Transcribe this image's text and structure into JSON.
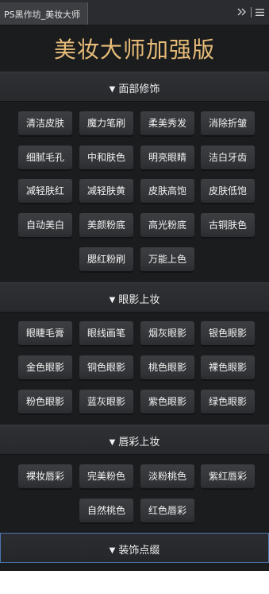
{
  "tab": {
    "label": "PS黑作坊_美妆大师"
  },
  "toolbar": {
    "collapse_icon": "double-chevron-right-icon",
    "menu_icon": "hamburger-menu-icon"
  },
  "app_title": "美妆大师加强版",
  "colors": {
    "title_gold": "#e8bc78",
    "panel_bg": "#1b1c1e",
    "active_border": "#4a76b0"
  },
  "sections": [
    {
      "title": "面部修饰",
      "expanded": true,
      "buttons": [
        "清洁皮肤",
        "魔力笔刷",
        "柔美秀发",
        "消除折皱",
        "细腻毛孔",
        "中和肤色",
        "明亮眼睛",
        "洁白牙齿",
        "减轻肤红",
        "减轻肤黄",
        "皮肤高饱",
        "皮肤低饱",
        "自动美白",
        "美颜粉底",
        "高光粉底",
        "古铜肤色",
        "腮红粉刷",
        "万能上色"
      ]
    },
    {
      "title": "眼影上妆",
      "expanded": true,
      "buttons": [
        "眼睫毛膏",
        "眼线画笔",
        "烟灰眼影",
        "银色眼影",
        "金色眼影",
        "铜色眼影",
        "桃色眼影",
        "裸色眼影",
        "粉色眼影",
        "蓝灰眼影",
        "紫色眼影",
        "绿色眼影"
      ]
    },
    {
      "title": "唇彩上妆",
      "expanded": true,
      "buttons": [
        "裸妆唇彩",
        "完美粉色",
        "淡粉桃色",
        "紫红唇彩",
        "自然桃色",
        "红色唇彩"
      ]
    },
    {
      "title": "装饰点缀",
      "expanded": false,
      "buttons": []
    }
  ]
}
